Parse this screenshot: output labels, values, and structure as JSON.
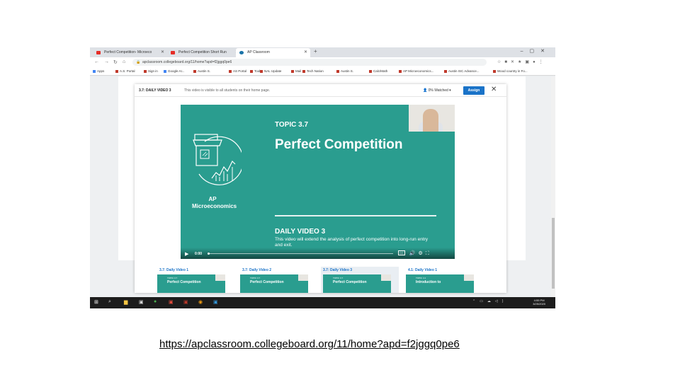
{
  "browser": {
    "tabs": [
      {
        "label": "Perfect Competition- Microeco",
        "favicon": "youtube-icon"
      },
      {
        "label": "Perfect Competition Short Run",
        "favicon": "youtube-icon"
      },
      {
        "label": "AP Classroom",
        "favicon": "ap-icon"
      }
    ],
    "address": "apclassroom.collegeboard.org/11/home?apd=f2jggq0pe6",
    "bookmarks": [
      "Apps",
      "A.S. Portal",
      "Sign in",
      "Google AI...",
      "Austin S.",
      "AS Portal",
      "Tools",
      "NAL Update",
      "Mail",
      "Tech Nation",
      "Austin S.",
      "Calc/Math",
      "AP Microeconomics...",
      "Austin ISC Advance...",
      "Wood country in Fo..."
    ]
  },
  "modal": {
    "title": "3.7: DAILY VIDEO 3",
    "subtitle": "This video is visible to all students on their home page.",
    "watched": "0% Watched",
    "assign_label": "Assign",
    "close_glyph": "✕"
  },
  "video": {
    "topic": "TOPIC 3.7",
    "title": "Perfect Competition",
    "course": "AP Microeconomics",
    "daily": "DAILY VIDEO 3",
    "description": "This video will extend the analysis of perfect competition into long-run entry and exit.",
    "time": "0:00",
    "progress": 0
  },
  "thumbnails": [
    {
      "label": "3.7: Daily Video 1",
      "topic": "TOPIC 3.7",
      "title": "Perfect Competition",
      "selected": false
    },
    {
      "label": "3.7: Daily Video 2",
      "topic": "TOPIC 3.7",
      "title": "Perfect Competition",
      "selected": false
    },
    {
      "label": "3.7: Daily Video 3",
      "topic": "TOPIC 3.7",
      "title": "Perfect Competition",
      "selected": true
    },
    {
      "label": "4.1: Daily Video 1",
      "topic": "TOPIC 4.1",
      "title": "Introduction to",
      "selected": false
    }
  ],
  "taskbar": {
    "time": "4:55 PM",
    "date": "3/25/2020"
  },
  "link": "https://apclassroom.collegeboard.org/11/home?apd=f2jggq0pe6",
  "colors": {
    "video_bg": "#2a9d8f",
    "accent": "#1a73c8"
  }
}
